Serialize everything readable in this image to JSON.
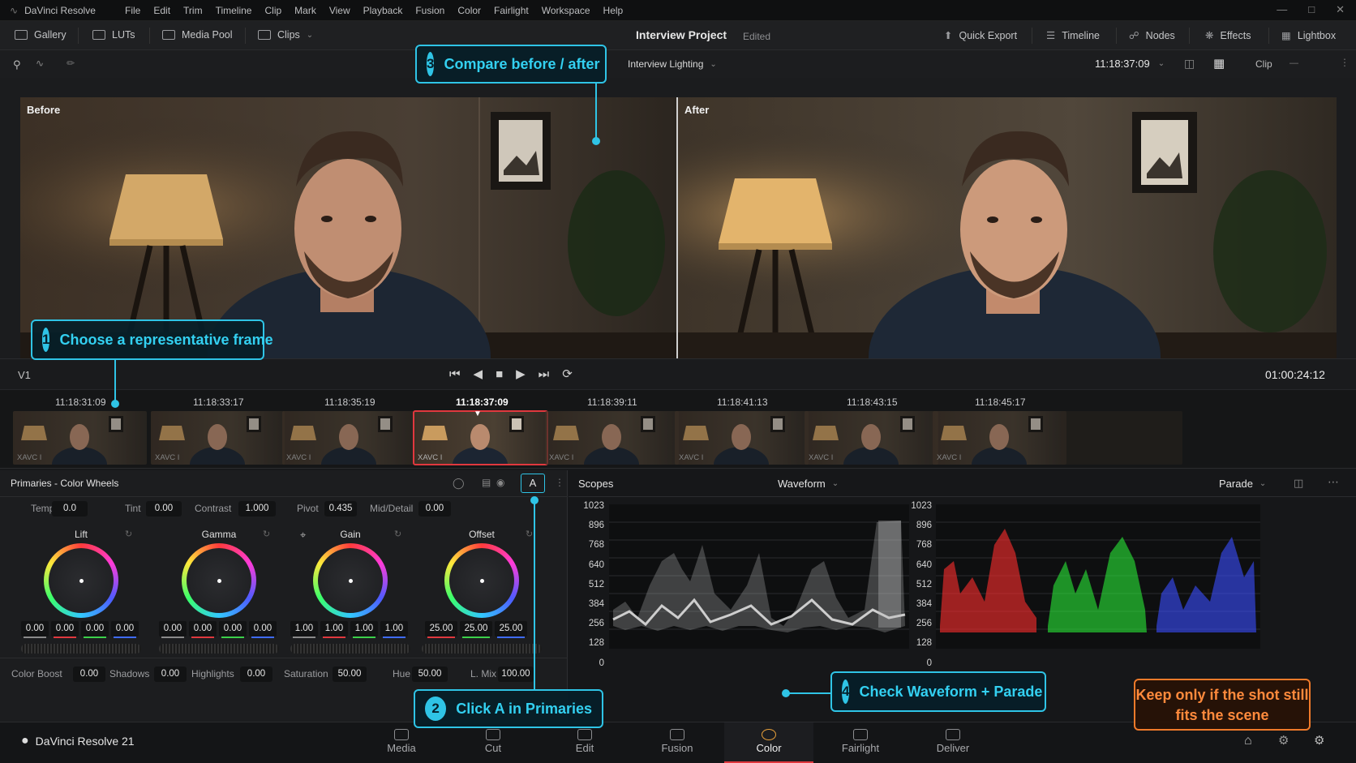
{
  "app": {
    "name": "DaVinci Resolve",
    "menus": [
      "File",
      "Edit",
      "Trim",
      "Timeline",
      "Clip",
      "Mark",
      "View",
      "Playback",
      "Fusion",
      "Color",
      "Fairlight",
      "Workspace",
      "Help"
    ]
  },
  "toolbar": {
    "gallery": "Gallery",
    "luts": "LUTs",
    "media_pool": "Media Pool",
    "clips": "Clips",
    "project_title": "Interview Project",
    "project_status": "Edited",
    "quick_export": "Quick Export",
    "timeline": "Timeline",
    "nodes": "Nodes",
    "effects": "Effects",
    "lightbox": "Lightbox"
  },
  "viewer_header": {
    "timeline_name": "Interview Lighting",
    "timecode": "11:18:37:09",
    "clip_label": "Clip"
  },
  "viewer": {
    "before_label": "Before",
    "after_label": "After"
  },
  "transport": {
    "track": "V1",
    "timecode": "01:00:24:12"
  },
  "thumbnails": [
    {
      "tc": "11:18:31:09",
      "label": "XAVC I",
      "selected": false
    },
    {
      "tc": "11:18:33:17",
      "label": "XAVC I",
      "selected": false
    },
    {
      "tc": "11:18:35:19",
      "label": "XAVC I",
      "selected": false
    },
    {
      "tc": "11:18:37:09",
      "label": "XAVC I",
      "selected": true
    },
    {
      "tc": "11:18:39:11",
      "label": "XAVC I",
      "selected": false
    },
    {
      "tc": "11:18:41:13",
      "label": "XAVC I",
      "selected": false
    },
    {
      "tc": "11:18:43:15",
      "label": "XAVC I",
      "selected": false
    },
    {
      "tc": "11:18:45:17",
      "label": "XAVC I",
      "selected": false
    }
  ],
  "primaries": {
    "title": "Primaries - Color Wheels",
    "mode_button": "A",
    "top_fields": [
      {
        "label": "Temp",
        "value": "0.0"
      },
      {
        "label": "Tint",
        "value": "0.00"
      },
      {
        "label": "Contrast",
        "value": "1.000"
      },
      {
        "label": "Pivot",
        "value": "0.435"
      },
      {
        "label": "Mid/Detail",
        "value": "0.00"
      }
    ],
    "wheels": [
      {
        "name": "Lift",
        "values": [
          "0.00",
          "0.00",
          "0.00",
          "0.00"
        ]
      },
      {
        "name": "Gamma",
        "values": [
          "0.00",
          "0.00",
          "0.00",
          "0.00"
        ]
      },
      {
        "name": "Gain",
        "values": [
          "1.00",
          "1.00",
          "1.00",
          "1.00"
        ]
      },
      {
        "name": "Offset",
        "values": [
          "25.00",
          "25.00",
          "25.00"
        ]
      }
    ],
    "bottom_fields": [
      {
        "label": "Color Boost",
        "value": "0.00"
      },
      {
        "label": "Shadows",
        "value": "0.00"
      },
      {
        "label": "Highlights",
        "value": "0.00"
      },
      {
        "label": "Saturation",
        "value": "50.00"
      },
      {
        "label": "Hue",
        "value": "50.00"
      },
      {
        "label": "L. Mix",
        "value": "100.00"
      }
    ]
  },
  "scopes": {
    "title": "Scopes",
    "type": "Waveform",
    "mode": "Parade",
    "scale": [
      "1023",
      "896",
      "768",
      "640",
      "512",
      "384",
      "256",
      "128",
      "0"
    ]
  },
  "pages": [
    "Media",
    "Cut",
    "Edit",
    "Fusion",
    "Color",
    "Fairlight",
    "Deliver"
  ],
  "active_page": "Color",
  "brand_footer": "DaVinci Resolve 21",
  "callouts": {
    "c1_num": "1",
    "c1_text": "Choose a representative frame",
    "c2_num": "2",
    "c2_text": "Click A in Primaries",
    "c3_num": "3",
    "c3_text": "Compare before / after",
    "c4_num": "4",
    "c4_text": "Check Waveform + Parade",
    "warning": "Keep only if the shot still fits the scene"
  },
  "colors": {
    "accent": "#2fc4e6",
    "warning": "#f07a2a",
    "active_tab": "#e0383e"
  }
}
